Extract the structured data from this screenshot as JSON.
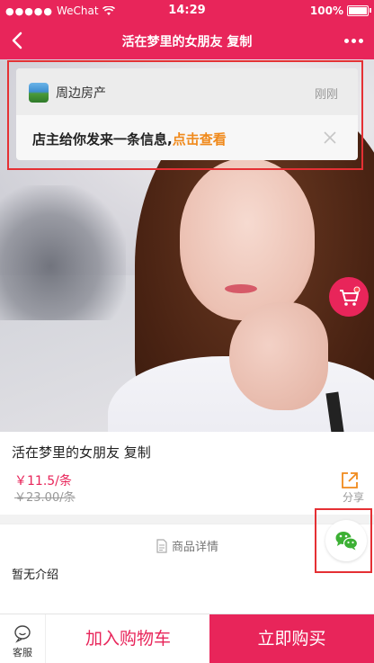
{
  "status_bar": {
    "signal": "●●●●●",
    "carrier": "WeChat",
    "time": "14:29",
    "battery": "100%"
  },
  "nav": {
    "title": "活在梦里的女朋友 复制"
  },
  "notification": {
    "app_name": "周边房产",
    "time": "刚刚",
    "message": "店主给你发来一条信息,",
    "link": "点击查看"
  },
  "product": {
    "name": "活在梦里的女朋友 复制",
    "price": "￥11.5/条",
    "original_price": "￥23.00/条",
    "share_label": "分享"
  },
  "detail": {
    "tab_label": "商品详情",
    "content": "暂无介绍"
  },
  "bottom_bar": {
    "service_label": "客服",
    "add_cart_label": "加入购物车",
    "buy_label": "立即购买"
  },
  "colors": {
    "brand": "#e8255a",
    "link": "#f08a1c",
    "highlight_outline": "#e53034",
    "wechat_green": "#3cb034"
  },
  "icons": [
    "wifi-icon",
    "back-icon",
    "more-icon",
    "close-icon",
    "cart-icon",
    "share-icon",
    "document-icon",
    "wechat-icon",
    "service-icon"
  ]
}
